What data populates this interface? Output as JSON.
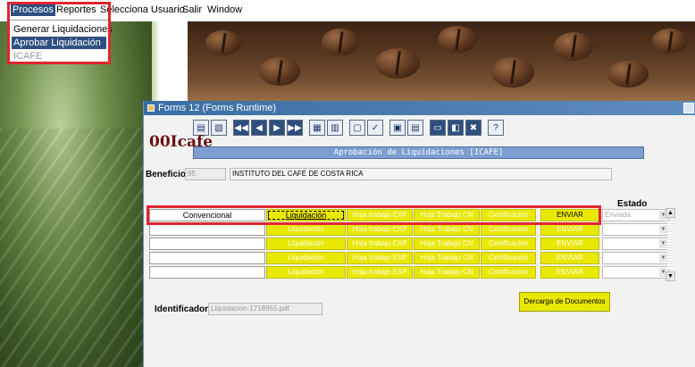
{
  "menubar": {
    "items": [
      {
        "label": "Procesos"
      },
      {
        "label": "Reportes"
      },
      {
        "label": "Selecciona Usuario"
      },
      {
        "label": "Salir"
      },
      {
        "label": "Window"
      }
    ]
  },
  "procesos_menu": {
    "items": [
      {
        "label": "Generar Liquidaciones"
      },
      {
        "label": "Aprobar Liquidación"
      },
      {
        "label": "ICAFE"
      }
    ]
  },
  "window": {
    "title": "Forms 12 (Forms Runtime)",
    "logo": "00Icafe",
    "form_title": "Aprobación de Liquidaciones [ICAFE]"
  },
  "beneficio": {
    "label": "Beneficio",
    "code": "95",
    "name": "INSTITUTO DEL CAFÉ DE COSTA RICA"
  },
  "grid": {
    "estado_header": "Estado",
    "buttons": {
      "liquidacion": "Liquidación",
      "hoja_exp": "Hoja trabajo EXP",
      "hoja_cn": "Hoja Trabajo CN",
      "certificacion": "Certificación",
      "enviar": "ENVIAR"
    },
    "rows": [
      {
        "tipo": "Convencional",
        "estado": "Enviada"
      },
      {
        "tipo": "",
        "estado": ""
      },
      {
        "tipo": "",
        "estado": ""
      },
      {
        "tipo": "",
        "estado": ""
      },
      {
        "tipo": "",
        "estado": ""
      }
    ]
  },
  "identificador": {
    "label": "Identificador",
    "value": "Liquidacion-1718955.pdf"
  },
  "dercarga_label": "Dercarga de Documentos",
  "colors": {
    "accent_yellow": "#e8e800",
    "highlight_red": "#e0262e",
    "title_blue": "#7c9ed0",
    "selection": "#2f4f7f"
  }
}
